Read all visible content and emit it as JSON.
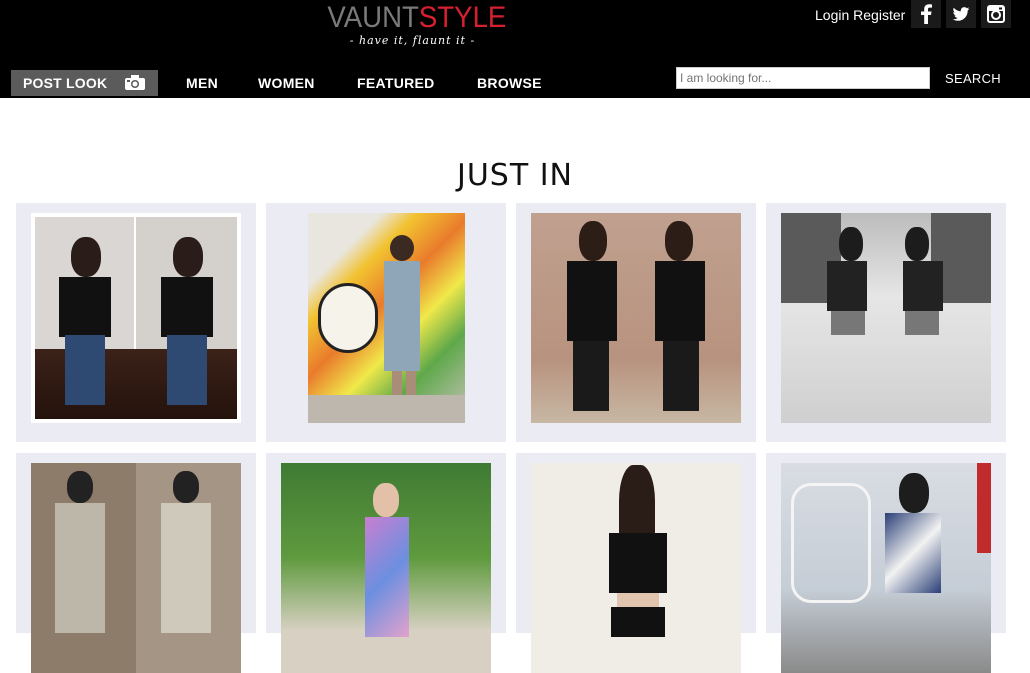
{
  "brand": {
    "name_part1": "VAUNT",
    "name_part2": "STYLE",
    "tagline": "- have it, flaunt it -"
  },
  "auth": {
    "login": "Login",
    "register": "Register"
  },
  "social": [
    "facebook-icon",
    "twitter-icon",
    "instagram-icon"
  ],
  "nav": {
    "post_look": "POST LOOK",
    "items": [
      "MEN",
      "WOMEN",
      "FEATURED",
      "BROWSE"
    ]
  },
  "search": {
    "placeholder": "I am looking for...",
    "button": "SEARCH"
  },
  "section": {
    "title": "JUST IN"
  },
  "colors": {
    "header_bg": "#000000",
    "brand_red": "#d6202f",
    "brand_grey": "#7a7a7a",
    "card_bg": "#ebebf3",
    "post_look_bg": "#5b5b5b"
  }
}
